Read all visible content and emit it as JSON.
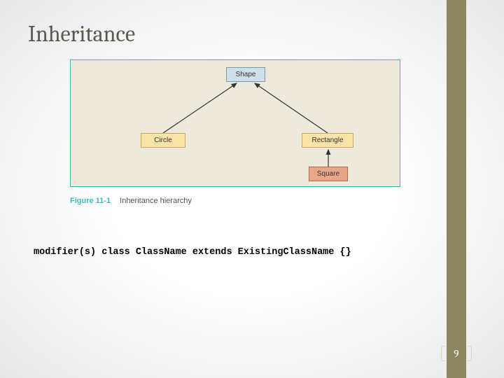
{
  "title": "Inheritance",
  "figure": {
    "label": "Figure 11-1",
    "caption": "Inheritance hierarchy",
    "nodes": {
      "shape": "Shape",
      "circle": "Circle",
      "rectangle": "Rectangle",
      "square": "Square"
    }
  },
  "code": "modifier(s) class ClassName extends ExistingClassName {}",
  "page_number": "9"
}
